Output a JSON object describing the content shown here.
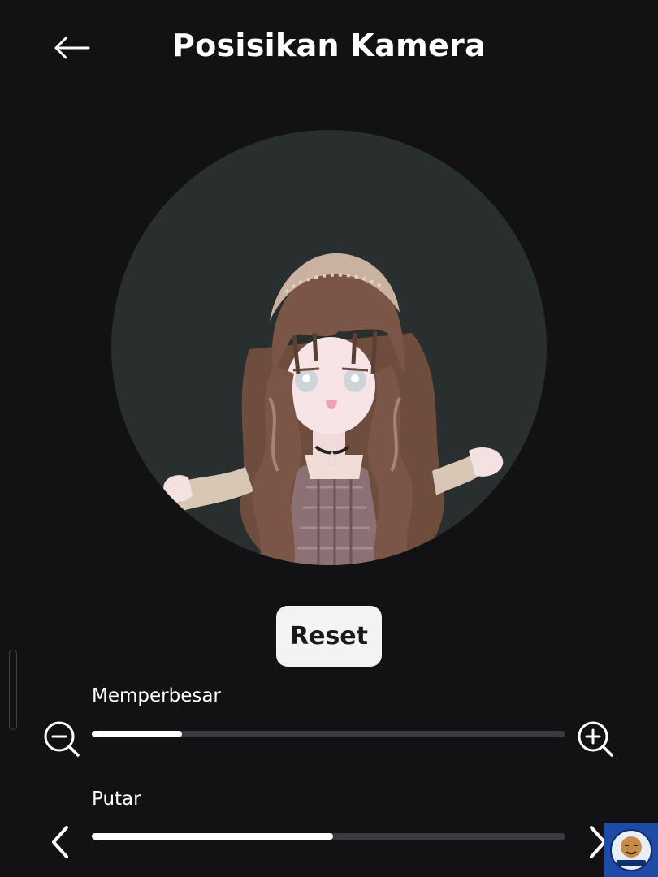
{
  "header": {
    "title": "Posisikan Kamera",
    "back_icon": "arrow-left-icon"
  },
  "preview": {
    "background_color": "#292e2e",
    "subject": "avatar-headshot"
  },
  "actions": {
    "reset_label": "Reset"
  },
  "zoom": {
    "label": "Memperbesar",
    "value": 0.19,
    "decrease_icon": "zoom-out-icon",
    "increase_icon": "zoom-in-icon"
  },
  "rotate": {
    "label": "Putar",
    "value": 0.51,
    "decrease_icon": "chevron-left-icon",
    "increase_icon": "chevron-right-icon"
  },
  "colors": {
    "background": "#121215",
    "track": "#393b41",
    "fill": "#ffffff",
    "button": "#f2f3f4"
  }
}
